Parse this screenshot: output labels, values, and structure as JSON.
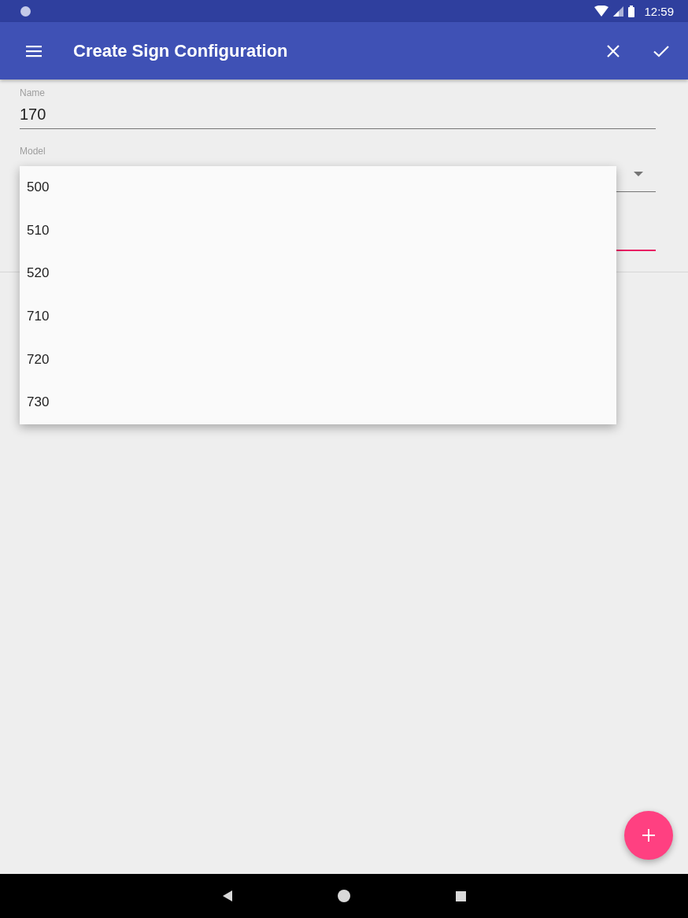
{
  "status_bar": {
    "time": "12:59"
  },
  "app_bar": {
    "title": "Create Sign Configuration"
  },
  "form": {
    "name": {
      "label": "Name",
      "value": "170"
    },
    "model": {
      "label": "Model"
    },
    "third_field": {
      "focused": true
    }
  },
  "dropdown": {
    "options": [
      "500",
      "510",
      "520",
      "710",
      "720",
      "730"
    ]
  }
}
